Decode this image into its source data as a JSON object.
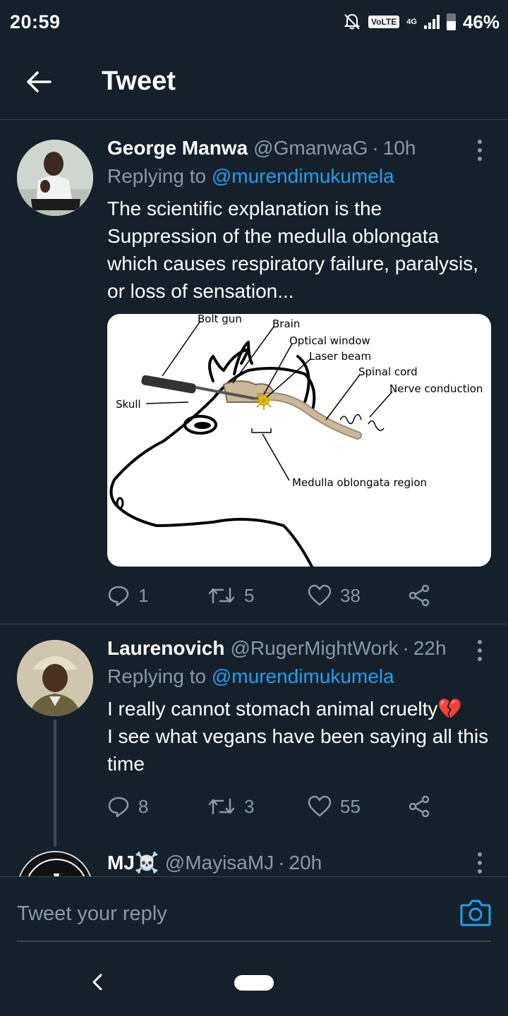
{
  "status_bar": {
    "time": "20:59",
    "volte": "VoLTE",
    "network": "4G",
    "battery": "46%"
  },
  "header": {
    "title": "Tweet"
  },
  "tweets": [
    {
      "name": "George Manwa",
      "handle": "@GmanwaG",
      "separator": "·",
      "time": "10h",
      "replying_prefix": "Replying to",
      "replying_to": "@murendimukumela",
      "text": "The scientific explanation is the Suppression of the medulla oblongata which causes respiratory failure, paralysis, or loss of sensation...",
      "replies": "1",
      "retweets": "5",
      "likes": "38",
      "image_labels": {
        "bolt_gun": "Bolt gun",
        "brain": "Brain",
        "optical_window": "Optical window",
        "laser_beam": "Laser beam",
        "spinal_cord": "Spinal cord",
        "nerve_conduction": "Nerve conduction",
        "skull": "Skull",
        "medulla": "Medulla oblongata region"
      }
    },
    {
      "name": "Laurenovich",
      "handle": "@RugerMightWork",
      "separator": "·",
      "time": "22h",
      "replying_prefix": "Replying to",
      "replying_to": "@murendimukumela",
      "text_line1": "I really cannot stomach animal cruelty💔",
      "text_line2": "I see what vegans have been saying all this time",
      "replies": "8",
      "retweets": "3",
      "likes": "55"
    },
    {
      "name": "MJ☠️",
      "handle": "@MayisaMJ",
      "separator": "·",
      "time": "20h"
    }
  ],
  "reply_bar": {
    "placeholder": "Tweet your reply"
  },
  "colors": {
    "background": "#15202b",
    "accent": "#1da1f2",
    "muted": "#8899a6",
    "divider": "#38444d"
  },
  "icons": [
    "back-arrow-icon",
    "more-vertical-icon",
    "reply-icon",
    "retweet-icon",
    "like-icon",
    "share-icon",
    "camera-icon",
    "nav-back-icon"
  ]
}
